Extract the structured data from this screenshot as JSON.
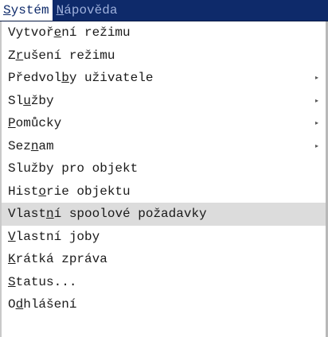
{
  "menubar": {
    "system": {
      "a": "",
      "m": "S",
      "b": "ystém"
    },
    "help": {
      "a": "",
      "m": "N",
      "b": "ápověda"
    }
  },
  "menu": {
    "items": [
      {
        "a": "Vytvoř",
        "m": "e",
        "b": "ní režimu",
        "arrow": ""
      },
      {
        "a": "Z",
        "m": "r",
        "b": "ušení režimu",
        "arrow": ""
      },
      {
        "a": "Předvol",
        "m": "b",
        "b": "y uživatele",
        "arrow": "▸"
      },
      {
        "a": "Sl",
        "m": "u",
        "b": "žby",
        "arrow": "▸"
      },
      {
        "a": "",
        "m": "P",
        "b": "omůcky",
        "arrow": "▸"
      },
      {
        "a": "Sez",
        "m": "n",
        "b": "am",
        "arrow": "▸"
      },
      {
        "a": "Služby pro objekt",
        "m": "",
        "b": "",
        "arrow": ""
      },
      {
        "a": "Hist",
        "m": "o",
        "b": "rie objektu",
        "arrow": ""
      },
      {
        "a": "Vlast",
        "m": "n",
        "b": "í spoolové požadavky",
        "arrow": ""
      },
      {
        "a": "",
        "m": "V",
        "b": "lastní joby",
        "arrow": ""
      },
      {
        "a": "",
        "m": "K",
        "b": "rátká zpráva",
        "arrow": ""
      },
      {
        "a": "",
        "m": "S",
        "b": "tatus...",
        "arrow": ""
      },
      {
        "a": "O",
        "m": "d",
        "b": "hlášení",
        "arrow": ""
      }
    ]
  }
}
